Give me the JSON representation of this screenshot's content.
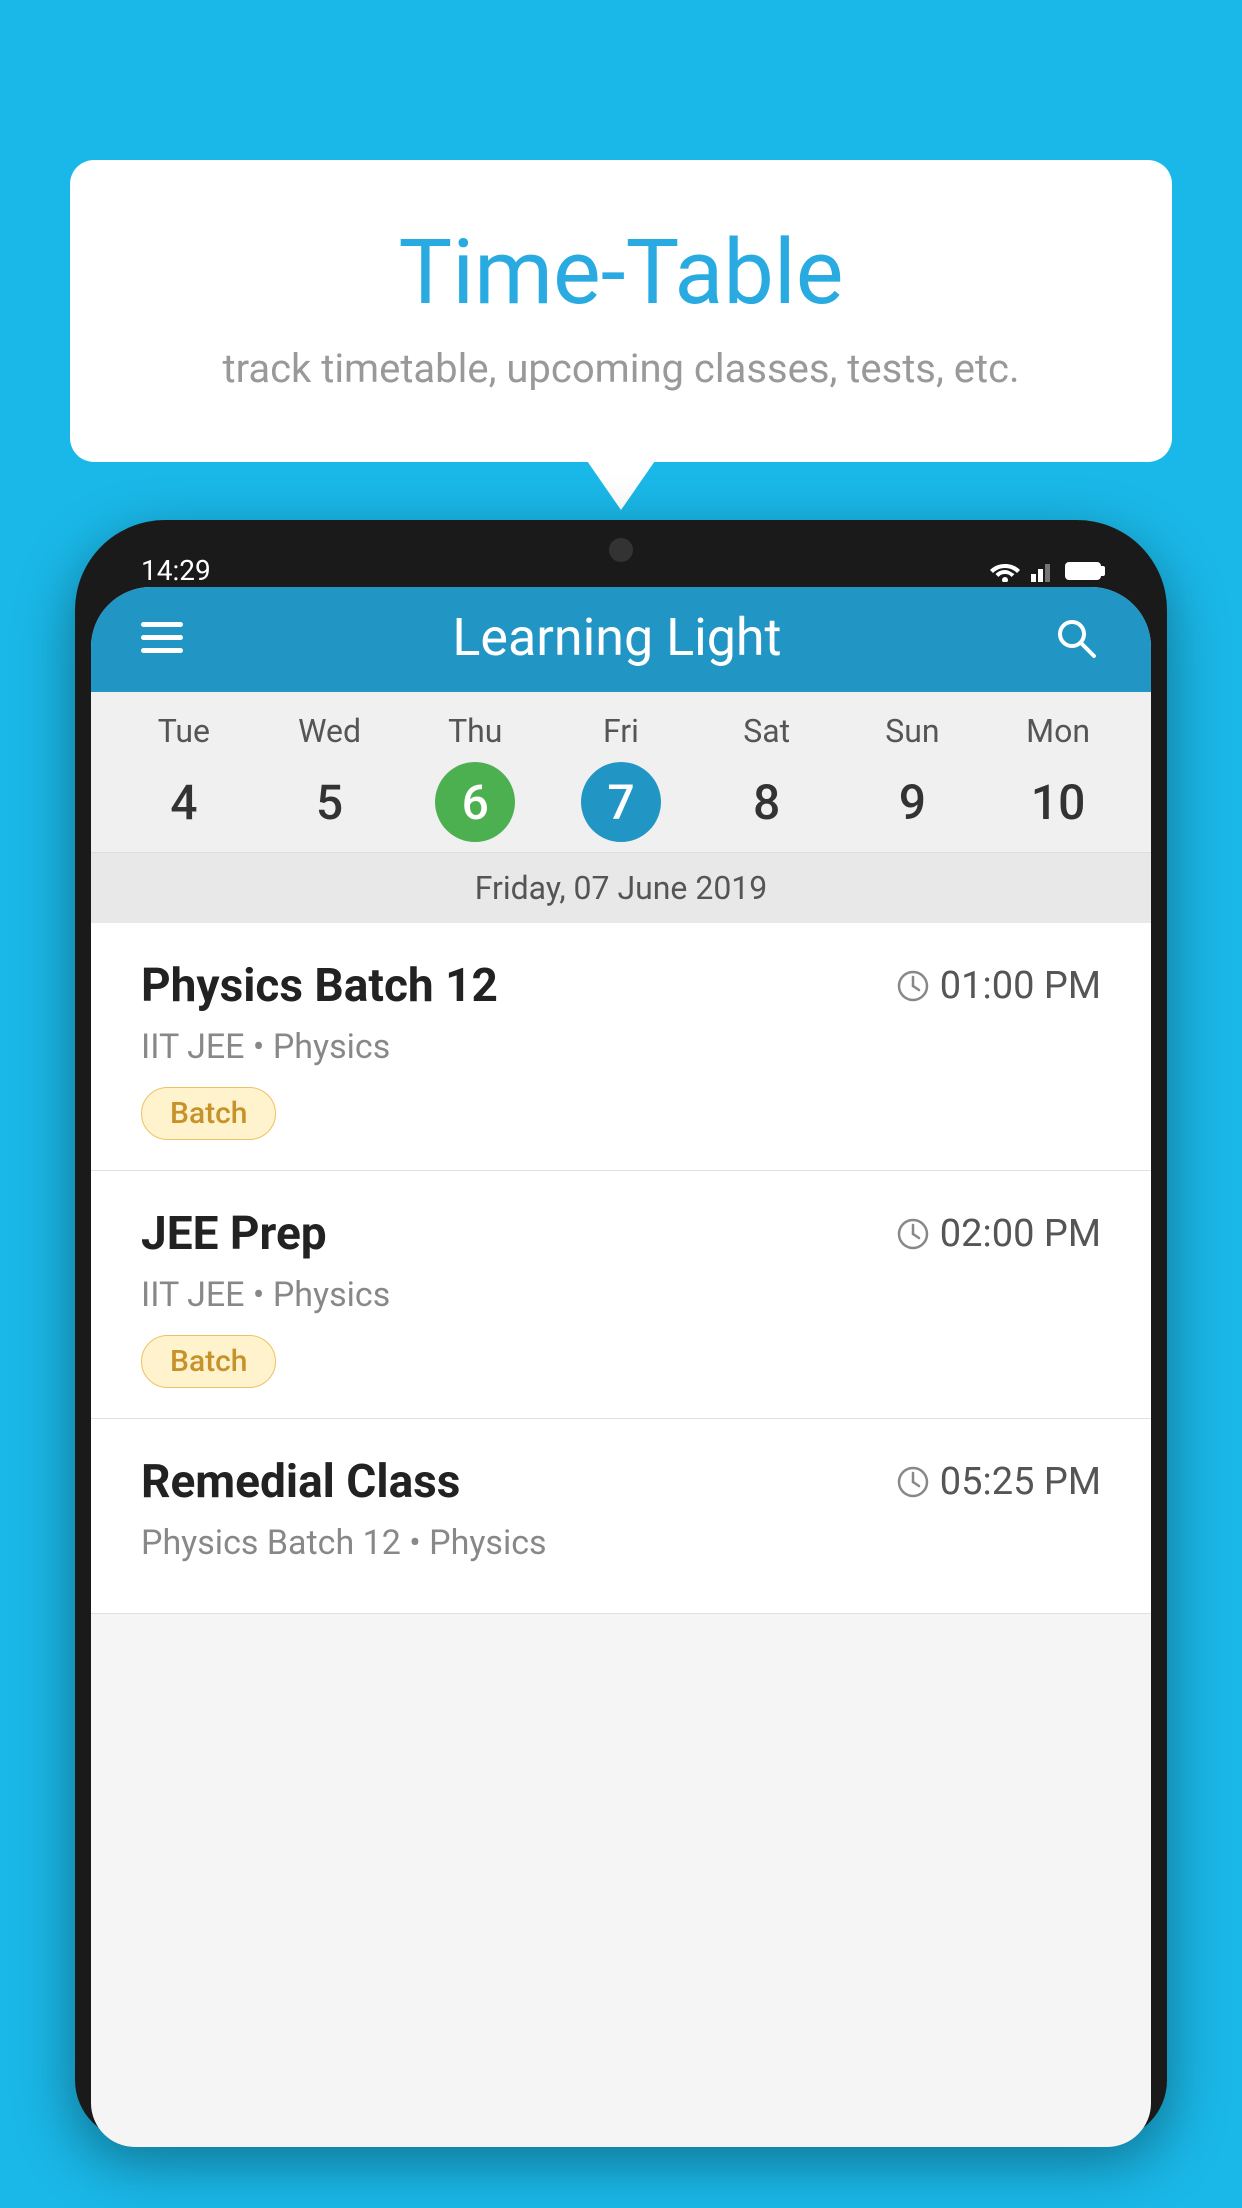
{
  "background_color": "#1ab8e8",
  "speech_bubble": {
    "title": "Time-Table",
    "subtitle": "track timetable, upcoming classes, tests, etc."
  },
  "phone": {
    "status_bar": {
      "time": "14:29"
    },
    "app_header": {
      "title": "Learning Light"
    },
    "calendar": {
      "days": [
        {
          "name": "Tue",
          "number": "4",
          "state": "normal"
        },
        {
          "name": "Wed",
          "number": "5",
          "state": "normal"
        },
        {
          "name": "Thu",
          "number": "6",
          "state": "today"
        },
        {
          "name": "Fri",
          "number": "7",
          "state": "selected"
        },
        {
          "name": "Sat",
          "number": "8",
          "state": "normal"
        },
        {
          "name": "Sun",
          "number": "9",
          "state": "normal"
        },
        {
          "name": "Mon",
          "number": "10",
          "state": "normal"
        }
      ],
      "selected_date_label": "Friday, 07 June 2019"
    },
    "schedule": [
      {
        "title": "Physics Batch 12",
        "time": "01:00 PM",
        "subtitle": "IIT JEE • Physics",
        "badge": "Batch"
      },
      {
        "title": "JEE Prep",
        "time": "02:00 PM",
        "subtitle": "IIT JEE • Physics",
        "badge": "Batch"
      },
      {
        "title": "Remedial Class",
        "time": "05:25 PM",
        "subtitle": "Physics Batch 12 • Physics",
        "badge": null
      }
    ]
  },
  "icons": {
    "hamburger": "☰",
    "search": "🔍",
    "clock": "🕐"
  }
}
